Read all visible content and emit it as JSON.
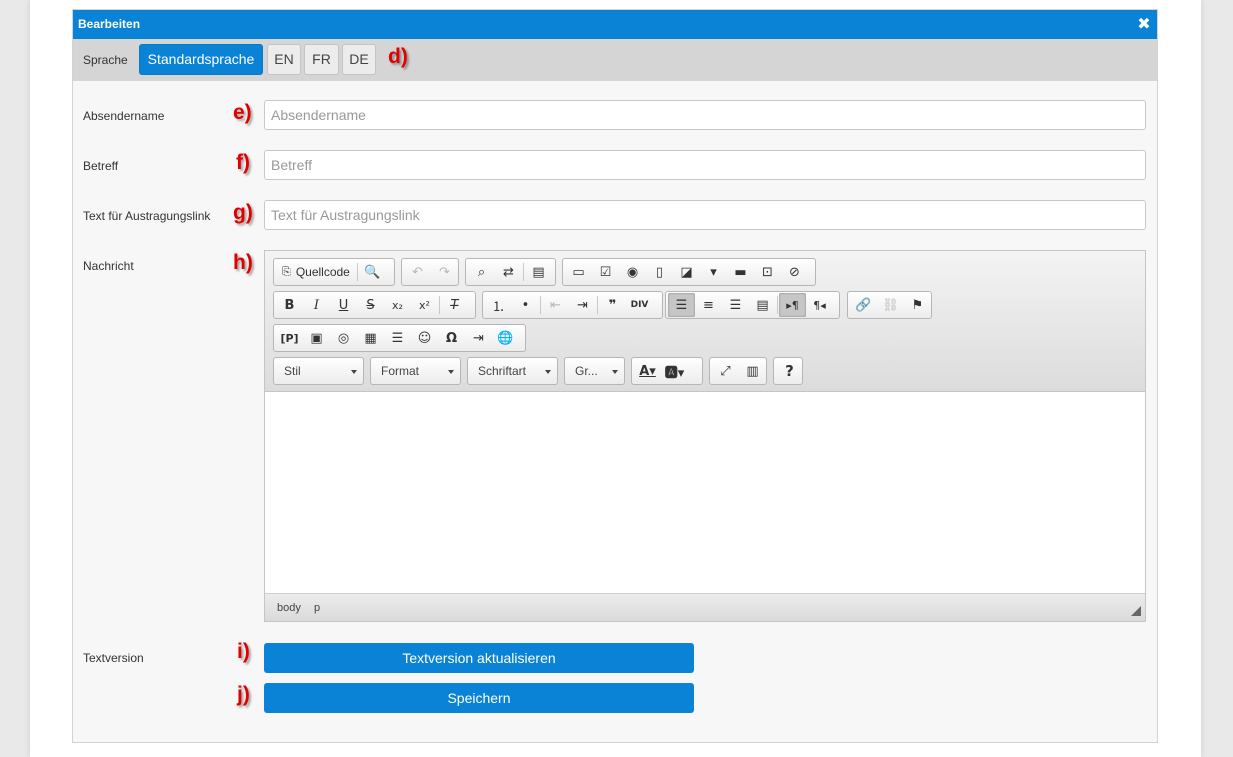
{
  "dialog": {
    "title": "Bearbeiten",
    "close_glyph": "✖"
  },
  "language": {
    "label": "Sprache",
    "options": [
      "Standardsprache",
      "EN",
      "FR",
      "DE"
    ],
    "active": "Standardsprache"
  },
  "markers": {
    "d": "d)",
    "e": "e)",
    "f": "f)",
    "g": "g)",
    "h": "h)",
    "i": "i)",
    "j": "j)"
  },
  "fields": {
    "sender_name": {
      "label": "Absendername",
      "placeholder": "Absendername",
      "value": ""
    },
    "subject": {
      "label": "Betreff",
      "placeholder": "Betreff",
      "value": ""
    },
    "unsubscribe_text": {
      "label": "Text für Austragungslink",
      "placeholder": "Text für Austragungslink",
      "value": ""
    },
    "message": {
      "label": "Nachricht"
    },
    "text_version": {
      "label": "Textversion"
    }
  },
  "editor": {
    "source_label": "Quellcode",
    "combos": {
      "style": "Stil",
      "format": "Format",
      "font": "Schriftart",
      "size": "Gr..."
    },
    "path": [
      "body",
      "p"
    ],
    "icons": [
      "source-icon",
      "preview-icon",
      "undo-icon",
      "redo-icon",
      "find-icon",
      "replace-icon",
      "select-all-icon",
      "form-icon",
      "checkbox-icon",
      "radio-icon",
      "textfield-icon",
      "textarea-icon",
      "select-icon",
      "button-icon",
      "image-button-icon",
      "hidden-field-icon",
      "bold-icon",
      "italic-icon",
      "underline-icon",
      "strike-icon",
      "subscript-icon",
      "superscript-icon",
      "remove-format-icon",
      "numbered-list-icon",
      "bulleted-list-icon",
      "outdent-icon",
      "indent-icon",
      "blockquote-icon",
      "div-icon",
      "align-left-icon",
      "align-center-icon",
      "align-right-icon",
      "justify-icon",
      "ltr-icon",
      "rtl-icon",
      "link-icon",
      "unlink-icon",
      "anchor-icon",
      "placeholder-icon",
      "image-icon",
      "flash-icon",
      "table-icon",
      "horizontal-rule-icon",
      "smiley-icon",
      "special-char-icon",
      "page-break-icon",
      "iframe-icon",
      "text-color-icon",
      "bg-color-icon",
      "maximize-icon",
      "show-blocks-icon",
      "help-icon"
    ]
  },
  "buttons": {
    "update_text_version": "Textversion aktualisieren",
    "save": "Speichern"
  },
  "colors": {
    "accent": "#0a83d6",
    "marker": "#e00000",
    "toolbar_bg": "#dcdcdc"
  }
}
